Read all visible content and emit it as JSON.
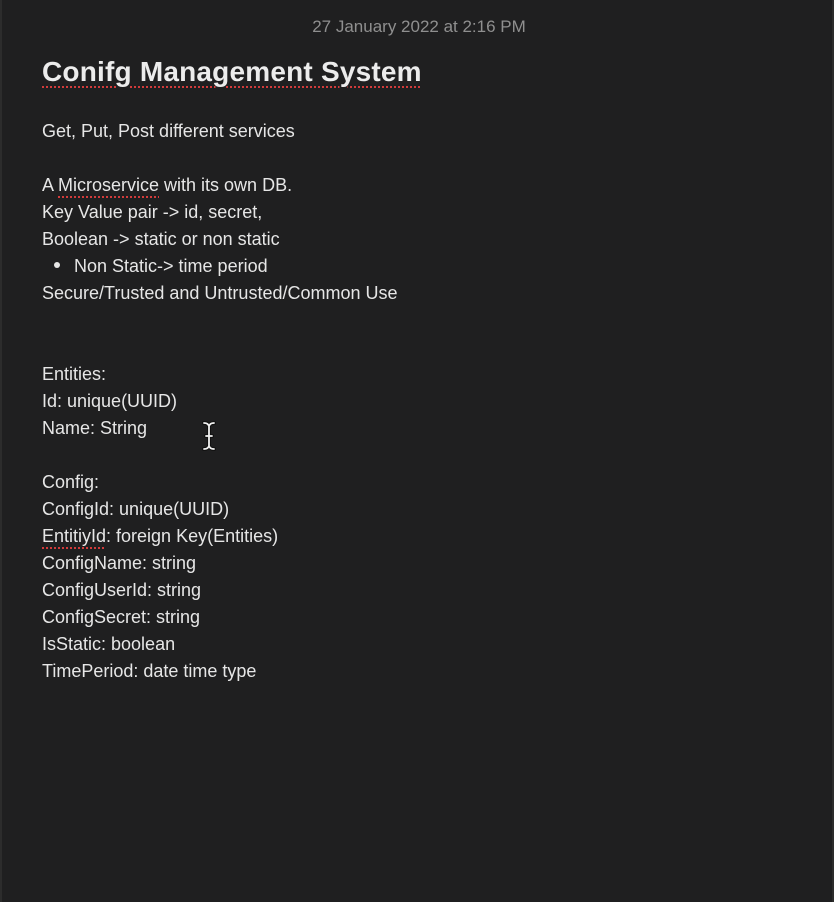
{
  "note": {
    "timestamp": "27 January 2022 at 2:16 PM",
    "title": "Conifg Management System",
    "lines": {
      "l1": "Get, Put, Post different services",
      "l2a_pre": "A ",
      "l2a_word": "Microservice",
      "l2a_post": " with its own DB.",
      "l3": "Key Value pair -> id, secret,",
      "l4": "Boolean -> static or non static",
      "l5_bullet": "Non Static-> time period",
      "l6": "Secure/Trusted and Untrusted/Common Use",
      "l7": "Entities:",
      "l8": "Id: unique(UUID)",
      "l9": "Name: String",
      "l10": "Config:",
      "l11": "ConfigId: unique(UUID)",
      "l12_word": "EntitiyId",
      "l12_post": ": foreign Key(Entities)",
      "l13": "ConfigName: string",
      "l14": "ConfigUserId: string",
      "l15": "ConfigSecret: string",
      "l16": "IsStatic: boolean",
      "l17": "TimePeriod: date time type"
    }
  },
  "icons": {
    "cursor": "text-cursor-ibeam-icon"
  },
  "colors": {
    "background": "#1f1f20",
    "text": "#e6e6e6",
    "timestamp": "#8f8f8f",
    "spellcheck": "#d23b3b"
  }
}
